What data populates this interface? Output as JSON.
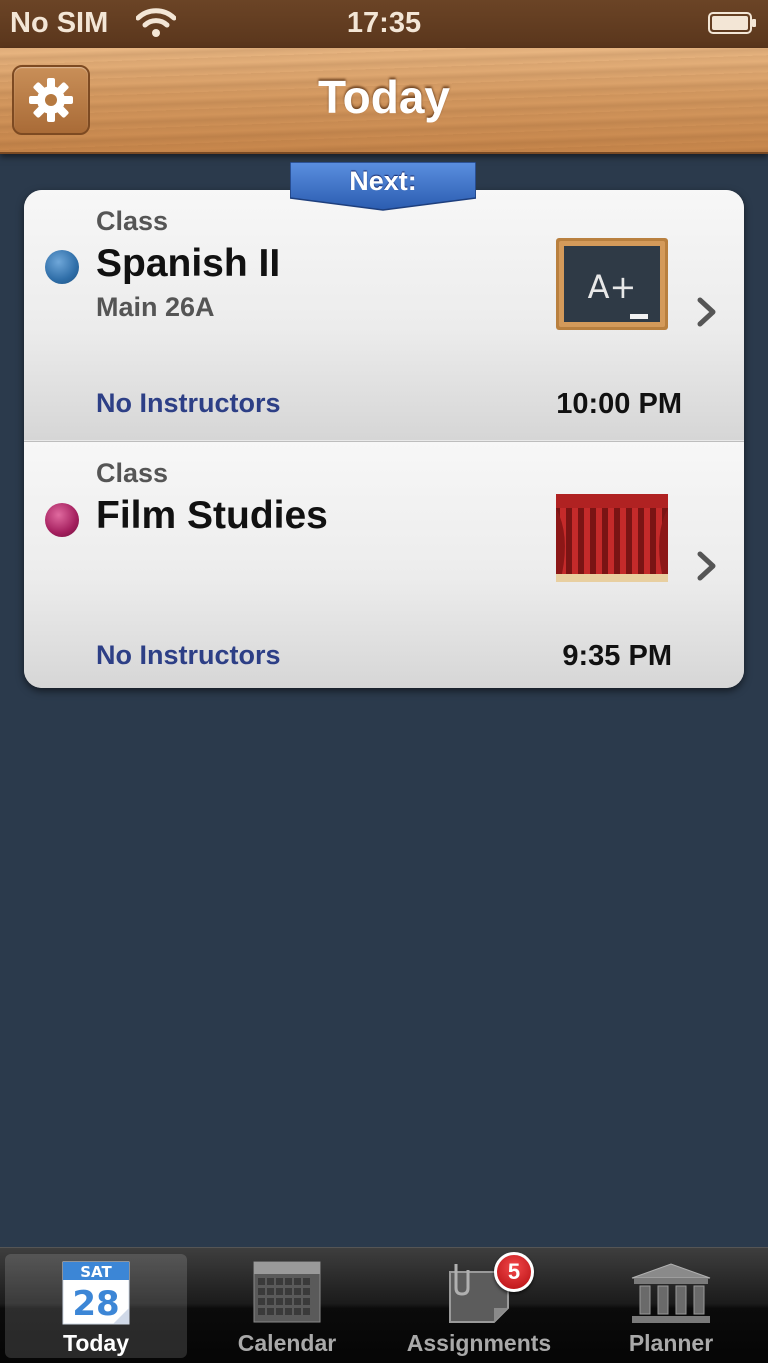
{
  "status_bar": {
    "carrier": "No SIM",
    "time": "17:35",
    "wifi_icon": "wifi-icon",
    "battery_icon": "battery-icon"
  },
  "nav": {
    "title": "Today",
    "settings_icon": "gear-icon"
  },
  "next_label": "Next:",
  "classes": [
    {
      "type": "Class",
      "name": "Spanish II",
      "location": "Main 26A",
      "instructors": "No Instructors",
      "time": "10:00 PM",
      "color": "#2f6ea8",
      "thumbnail": "chalkboard-icon",
      "thumbnail_text": "A+"
    },
    {
      "type": "Class",
      "name": "Film Studies",
      "location": "",
      "instructors": "No Instructors",
      "time": "9:35 PM",
      "color": "#a41f5e",
      "thumbnail": "theater-curtain-icon"
    }
  ],
  "tabs": [
    {
      "label": "Today",
      "icon": "calendar-day-icon",
      "day": "SAT",
      "date": "28",
      "selected": true
    },
    {
      "label": "Calendar",
      "icon": "calendar-grid-icon",
      "selected": false
    },
    {
      "label": "Assignments",
      "icon": "assignments-icon",
      "badge": "5",
      "selected": false
    },
    {
      "label": "Planner",
      "icon": "planner-icon",
      "selected": false
    }
  ],
  "colors": {
    "accent_blue": "#2d3f86",
    "background": "#2b3a4c",
    "wood": "#d69b62",
    "ribbon": "#3f6fc3"
  }
}
